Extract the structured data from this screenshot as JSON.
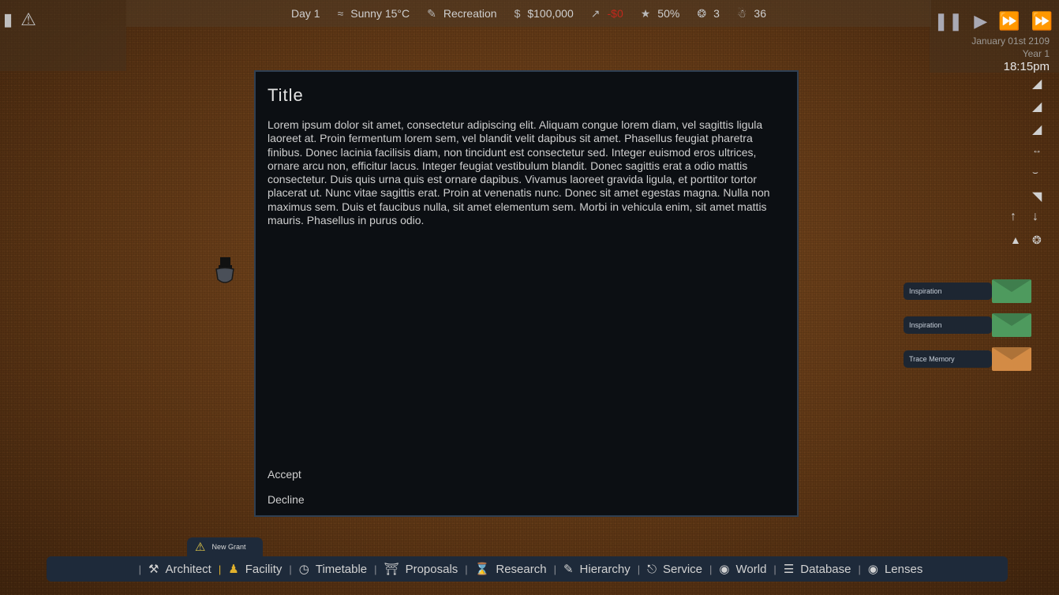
{
  "topbar": {
    "day": "Day 1",
    "weather": "Sunny 15°C",
    "activity": "Recreation",
    "money": "$100,000",
    "income": "-$0",
    "satisfaction": "50%",
    "guards": "3",
    "population": "36"
  },
  "datetime": {
    "date": "January 01st 2109",
    "year": "Year 1",
    "time": "18:15pm"
  },
  "modal": {
    "title": "Title",
    "body": "Lorem ipsum dolor sit amet, consectetur adipiscing elit. Aliquam congue lorem diam, vel sagittis ligula laoreet at. Proin fermentum lorem sem, vel blandit velit dapibus sit amet. Phasellus feugiat pharetra finibus. Donec lacinia facilisis diam, non tincidunt est consectetur sed. Integer euismod eros ultrices, ornare arcu non, efficitur lacus. Integer feugiat vestibulum blandit. Donec sagittis erat a odio mattis consectetur. Duis quis urna quis est ornare dapibus. Vivamus laoreet gravida ligula, et porttitor tortor placerat ut. Nunc vitae sagittis erat. Proin at venenatis nunc. Donec sit amet egestas magna. Nulla non maximus sem. Duis et faucibus nulla, sit amet elementum sem. Morbi in vehicula enim, sit amet mattis mauris. Phasellus in purus odio.",
    "accept": "Accept",
    "decline": "Decline"
  },
  "notifications": [
    {
      "label": "Inspiration",
      "color": "#4e9a5e"
    },
    {
      "label": "Inspiration",
      "color": "#4e9a5e"
    },
    {
      "label": "Trace Memory",
      "color": "#d38b45"
    }
  ],
  "grant": {
    "label": "New Grant"
  },
  "bottombar": {
    "architect": "Architect",
    "facility": "Facility",
    "timetable": "Timetable",
    "proposals": "Proposals",
    "research": "Research",
    "hierarchy": "Hierarchy",
    "service": "Service",
    "world": "World",
    "database": "Database",
    "lenses": "Lenses"
  },
  "colors": {
    "accent": "#e1b12c",
    "negative": "#c0281c",
    "panel": "#1e2a3a"
  }
}
